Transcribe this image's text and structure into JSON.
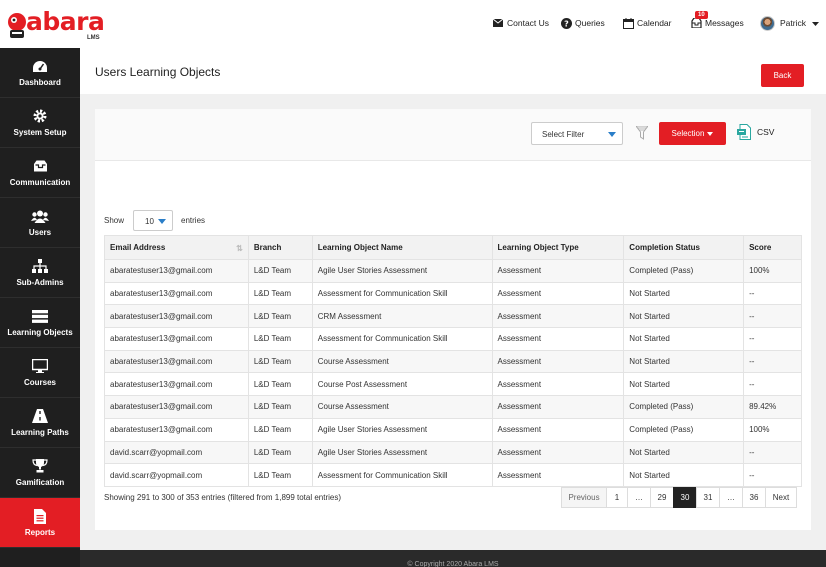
{
  "brand": {
    "name": "abara",
    "sub": "LMS"
  },
  "top_nav": {
    "contact": "Contact Us",
    "queries": "Queries",
    "calendar": "Calendar",
    "messages": "Messages",
    "messages_count": "10",
    "user": "Patrick"
  },
  "sidebar": {
    "items": [
      {
        "label": "Dashboard",
        "icon": "dashboard-icon"
      },
      {
        "label": "System Setup",
        "icon": "gear-icon"
      },
      {
        "label": "Communication",
        "icon": "inbox-icon"
      },
      {
        "label": "Users",
        "icon": "users-icon"
      },
      {
        "label": "Sub-Admins",
        "icon": "sitemap-icon"
      },
      {
        "label": "Learning Objects",
        "icon": "stack-icon"
      },
      {
        "label": "Courses",
        "icon": "monitor-icon"
      },
      {
        "label": "Learning Paths",
        "icon": "road-icon"
      },
      {
        "label": "Gamification",
        "icon": "trophy-icon"
      },
      {
        "label": "Reports",
        "icon": "report-icon"
      }
    ],
    "active": "Reports"
  },
  "page": {
    "title": "Users Learning Objects",
    "back_label": "Back"
  },
  "filters": {
    "select_filter": "Select Filter",
    "selection_label": "Selection",
    "csv_label": "CSV"
  },
  "length": {
    "show": "Show",
    "value": "10",
    "entries": "entries"
  },
  "table": {
    "columns": [
      "Email Address",
      "Branch",
      "Learning Object Name",
      "Learning Object Type",
      "Completion Status",
      "Score"
    ],
    "rows": [
      [
        "abaratestuser13@gmail.com",
        "L&D Team",
        "Agile User Stories Assessment",
        "Assessment",
        "Completed (Pass)",
        "100%"
      ],
      [
        "abaratestuser13@gmail.com",
        "L&D Team",
        "Assessment for Communication Skill",
        "Assessment",
        "Not Started",
        "--"
      ],
      [
        "abaratestuser13@gmail.com",
        "L&D Team",
        "CRM Assessment",
        "Assessment",
        "Not Started",
        "--"
      ],
      [
        "abaratestuser13@gmail.com",
        "L&D Team",
        "Assessment for Communication Skill",
        "Assessment",
        "Not Started",
        "--"
      ],
      [
        "abaratestuser13@gmail.com",
        "L&D Team",
        "Course Assessment",
        "Assessment",
        "Not Started",
        "--"
      ],
      [
        "abaratestuser13@gmail.com",
        "L&D Team",
        "Course Post Assessment",
        "Assessment",
        "Not Started",
        "--"
      ],
      [
        "abaratestuser13@gmail.com",
        "L&D Team",
        "Course Assessment",
        "Assessment",
        "Completed (Pass)",
        "89.42%"
      ],
      [
        "abaratestuser13@gmail.com",
        "L&D Team",
        "Agile User Stories Assessment",
        "Assessment",
        "Completed (Pass)",
        "100%"
      ],
      [
        "david.scarr@yopmail.com",
        "L&D Team",
        "Agile User Stories Assessment",
        "Assessment",
        "Not Started",
        "--"
      ],
      [
        "david.scarr@yopmail.com",
        "L&D Team",
        "Assessment for Communication Skill",
        "Assessment",
        "Not Started",
        "--"
      ]
    ]
  },
  "info": "Showing 291 to 300 of 353 entries (filtered from 1,899 total entries)",
  "pagination": [
    "Previous",
    "1",
    "…",
    "29",
    "30",
    "31",
    "…",
    "36",
    "Next"
  ],
  "pagination_current": "30",
  "footer": "© Copyright 2020 Abara LMS",
  "colors": {
    "accent": "#e31e24",
    "sidebar": "#1f1f1f",
    "link": "#2a7ec8"
  }
}
